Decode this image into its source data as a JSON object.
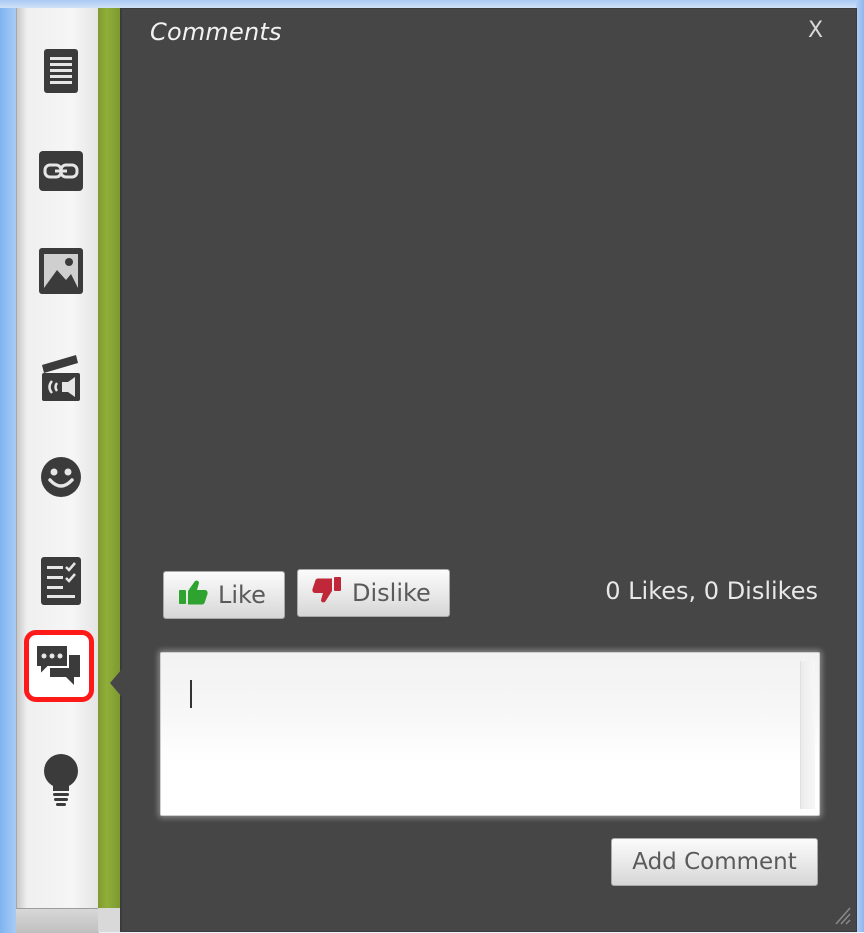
{
  "panel": {
    "title": "Comments",
    "close_label": "X"
  },
  "toolbar": {
    "items": [
      {
        "name": "document",
        "icon": "document-lines-icon",
        "active": false
      },
      {
        "name": "link",
        "icon": "link-icon",
        "active": false
      },
      {
        "name": "image",
        "icon": "image-icon",
        "active": false
      },
      {
        "name": "media",
        "icon": "clapperboard-audio-icon",
        "active": false
      },
      {
        "name": "emoji",
        "icon": "smiley-icon",
        "active": false
      },
      {
        "name": "checklist",
        "icon": "checklist-icon",
        "active": false
      },
      {
        "name": "comments",
        "icon": "chat-bubbles-icon",
        "active": true
      },
      {
        "name": "ideas",
        "icon": "lightbulb-icon",
        "active": false
      }
    ]
  },
  "reactions": {
    "like_label": "Like",
    "dislike_label": "Dislike",
    "counts_text": "0 Likes, 0 Dislikes"
  },
  "comment_box": {
    "value": "",
    "submit_label": "Add Comment"
  },
  "colors": {
    "panel_bg": "#464646",
    "accent_green": "#8fae3a",
    "highlight_red": "#ff1a1a",
    "like_green": "#2fa32f",
    "dislike_red": "#c0283a"
  }
}
